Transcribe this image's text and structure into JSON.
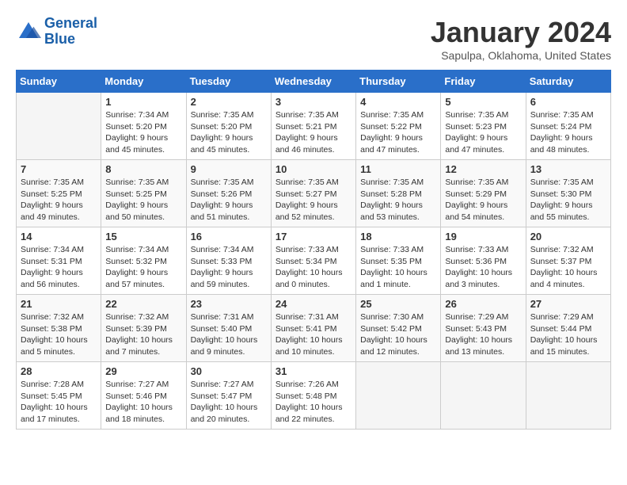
{
  "header": {
    "logo_line1": "General",
    "logo_line2": "Blue",
    "month": "January 2024",
    "location": "Sapulpa, Oklahoma, United States"
  },
  "days_of_week": [
    "Sunday",
    "Monday",
    "Tuesday",
    "Wednesday",
    "Thursday",
    "Friday",
    "Saturday"
  ],
  "weeks": [
    [
      {
        "num": "",
        "sunrise": "",
        "sunset": "",
        "daylight": "",
        "empty": true
      },
      {
        "num": "1",
        "sunrise": "Sunrise: 7:34 AM",
        "sunset": "Sunset: 5:20 PM",
        "daylight": "Daylight: 9 hours and 45 minutes."
      },
      {
        "num": "2",
        "sunrise": "Sunrise: 7:35 AM",
        "sunset": "Sunset: 5:20 PM",
        "daylight": "Daylight: 9 hours and 45 minutes."
      },
      {
        "num": "3",
        "sunrise": "Sunrise: 7:35 AM",
        "sunset": "Sunset: 5:21 PM",
        "daylight": "Daylight: 9 hours and 46 minutes."
      },
      {
        "num": "4",
        "sunrise": "Sunrise: 7:35 AM",
        "sunset": "Sunset: 5:22 PM",
        "daylight": "Daylight: 9 hours and 47 minutes."
      },
      {
        "num": "5",
        "sunrise": "Sunrise: 7:35 AM",
        "sunset": "Sunset: 5:23 PM",
        "daylight": "Daylight: 9 hours and 47 minutes."
      },
      {
        "num": "6",
        "sunrise": "Sunrise: 7:35 AM",
        "sunset": "Sunset: 5:24 PM",
        "daylight": "Daylight: 9 hours and 48 minutes."
      }
    ],
    [
      {
        "num": "7",
        "sunrise": "Sunrise: 7:35 AM",
        "sunset": "Sunset: 5:25 PM",
        "daylight": "Daylight: 9 hours and 49 minutes."
      },
      {
        "num": "8",
        "sunrise": "Sunrise: 7:35 AM",
        "sunset": "Sunset: 5:25 PM",
        "daylight": "Daylight: 9 hours and 50 minutes."
      },
      {
        "num": "9",
        "sunrise": "Sunrise: 7:35 AM",
        "sunset": "Sunset: 5:26 PM",
        "daylight": "Daylight: 9 hours and 51 minutes."
      },
      {
        "num": "10",
        "sunrise": "Sunrise: 7:35 AM",
        "sunset": "Sunset: 5:27 PM",
        "daylight": "Daylight: 9 hours and 52 minutes."
      },
      {
        "num": "11",
        "sunrise": "Sunrise: 7:35 AM",
        "sunset": "Sunset: 5:28 PM",
        "daylight": "Daylight: 9 hours and 53 minutes."
      },
      {
        "num": "12",
        "sunrise": "Sunrise: 7:35 AM",
        "sunset": "Sunset: 5:29 PM",
        "daylight": "Daylight: 9 hours and 54 minutes."
      },
      {
        "num": "13",
        "sunrise": "Sunrise: 7:35 AM",
        "sunset": "Sunset: 5:30 PM",
        "daylight": "Daylight: 9 hours and 55 minutes."
      }
    ],
    [
      {
        "num": "14",
        "sunrise": "Sunrise: 7:34 AM",
        "sunset": "Sunset: 5:31 PM",
        "daylight": "Daylight: 9 hours and 56 minutes."
      },
      {
        "num": "15",
        "sunrise": "Sunrise: 7:34 AM",
        "sunset": "Sunset: 5:32 PM",
        "daylight": "Daylight: 9 hours and 57 minutes."
      },
      {
        "num": "16",
        "sunrise": "Sunrise: 7:34 AM",
        "sunset": "Sunset: 5:33 PM",
        "daylight": "Daylight: 9 hours and 59 minutes."
      },
      {
        "num": "17",
        "sunrise": "Sunrise: 7:33 AM",
        "sunset": "Sunset: 5:34 PM",
        "daylight": "Daylight: 10 hours and 0 minutes."
      },
      {
        "num": "18",
        "sunrise": "Sunrise: 7:33 AM",
        "sunset": "Sunset: 5:35 PM",
        "daylight": "Daylight: 10 hours and 1 minute."
      },
      {
        "num": "19",
        "sunrise": "Sunrise: 7:33 AM",
        "sunset": "Sunset: 5:36 PM",
        "daylight": "Daylight: 10 hours and 3 minutes."
      },
      {
        "num": "20",
        "sunrise": "Sunrise: 7:32 AM",
        "sunset": "Sunset: 5:37 PM",
        "daylight": "Daylight: 10 hours and 4 minutes."
      }
    ],
    [
      {
        "num": "21",
        "sunrise": "Sunrise: 7:32 AM",
        "sunset": "Sunset: 5:38 PM",
        "daylight": "Daylight: 10 hours and 5 minutes."
      },
      {
        "num": "22",
        "sunrise": "Sunrise: 7:32 AM",
        "sunset": "Sunset: 5:39 PM",
        "daylight": "Daylight: 10 hours and 7 minutes."
      },
      {
        "num": "23",
        "sunrise": "Sunrise: 7:31 AM",
        "sunset": "Sunset: 5:40 PM",
        "daylight": "Daylight: 10 hours and 9 minutes."
      },
      {
        "num": "24",
        "sunrise": "Sunrise: 7:31 AM",
        "sunset": "Sunset: 5:41 PM",
        "daylight": "Daylight: 10 hours and 10 minutes."
      },
      {
        "num": "25",
        "sunrise": "Sunrise: 7:30 AM",
        "sunset": "Sunset: 5:42 PM",
        "daylight": "Daylight: 10 hours and 12 minutes."
      },
      {
        "num": "26",
        "sunrise": "Sunrise: 7:29 AM",
        "sunset": "Sunset: 5:43 PM",
        "daylight": "Daylight: 10 hours and 13 minutes."
      },
      {
        "num": "27",
        "sunrise": "Sunrise: 7:29 AM",
        "sunset": "Sunset: 5:44 PM",
        "daylight": "Daylight: 10 hours and 15 minutes."
      }
    ],
    [
      {
        "num": "28",
        "sunrise": "Sunrise: 7:28 AM",
        "sunset": "Sunset: 5:45 PM",
        "daylight": "Daylight: 10 hours and 17 minutes."
      },
      {
        "num": "29",
        "sunrise": "Sunrise: 7:27 AM",
        "sunset": "Sunset: 5:46 PM",
        "daylight": "Daylight: 10 hours and 18 minutes."
      },
      {
        "num": "30",
        "sunrise": "Sunrise: 7:27 AM",
        "sunset": "Sunset: 5:47 PM",
        "daylight": "Daylight: 10 hours and 20 minutes."
      },
      {
        "num": "31",
        "sunrise": "Sunrise: 7:26 AM",
        "sunset": "Sunset: 5:48 PM",
        "daylight": "Daylight: 10 hours and 22 minutes."
      },
      {
        "num": "",
        "sunrise": "",
        "sunset": "",
        "daylight": "",
        "empty": true
      },
      {
        "num": "",
        "sunrise": "",
        "sunset": "",
        "daylight": "",
        "empty": true
      },
      {
        "num": "",
        "sunrise": "",
        "sunset": "",
        "daylight": "",
        "empty": true
      }
    ]
  ]
}
